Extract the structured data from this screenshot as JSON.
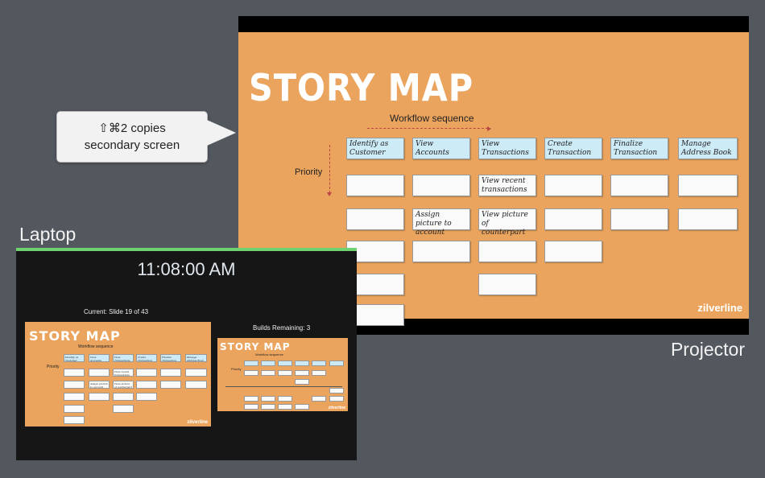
{
  "slide": {
    "title": "STORY MAP",
    "workflow_label": "Workflow sequence",
    "priority_label": "Priority",
    "brand": "zilverline",
    "headers": [
      "Identify as Customer",
      "View Accounts",
      "View Transactions",
      "Create Transaction",
      "Finalize Transaction",
      "Manage Address Book"
    ],
    "cards": {
      "c2r1": "View recent transactions",
      "c1r2": "Assign picture to account",
      "c2r2": "View picture of counterpart"
    }
  },
  "callout": {
    "line1": "⇧⌘2 copies",
    "line2": "secondary screen"
  },
  "labels": {
    "laptop": "Laptop",
    "projector": "Projector"
  },
  "presenter": {
    "clock": "11:08:00 AM",
    "current": "Current: Slide 19 of 43",
    "builds": "Builds Remaining: 3"
  },
  "colors": {
    "background": "#53575e",
    "slide": "#eba45e",
    "header_card": "#cdeaf7",
    "laptop_bar": "#6fd16f"
  }
}
